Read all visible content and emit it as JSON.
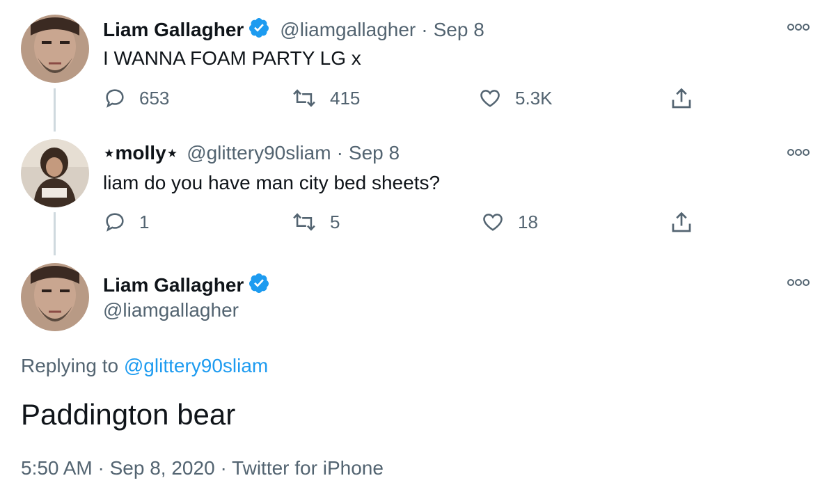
{
  "tweet1": {
    "name": "Liam Gallagher",
    "handle": "@liamgallagher",
    "separator": "·",
    "date": "Sep 8",
    "text": "I WANNA FOAM PARTY LG x",
    "replies": "653",
    "retweets": "415",
    "likes": "5.3K"
  },
  "tweet2": {
    "name": "⋆molly⋆",
    "handle": "@glittery90sliam",
    "separator": "·",
    "date": "Sep 8",
    "text": "liam do you have man city bed sheets?",
    "replies": "1",
    "retweets": "5",
    "likes": "18"
  },
  "main": {
    "name": "Liam Gallagher",
    "handle": "@liamgallagher",
    "replying_label": "Replying to",
    "replying_handle": "@glittery90sliam",
    "text": "Paddington bear",
    "time": "5:50 AM",
    "sep1": "·",
    "date": "Sep 8, 2020",
    "sep2": "·",
    "source": "Twitter for iPhone"
  },
  "colors": {
    "accent": "#1d9bf0",
    "muted": "#536471",
    "text": "#0f1419",
    "thread_line": "#cfd9de"
  },
  "icons": [
    "reply-icon",
    "retweet-icon",
    "like-icon",
    "share-icon",
    "more-icon",
    "verified-badge-icon"
  ]
}
